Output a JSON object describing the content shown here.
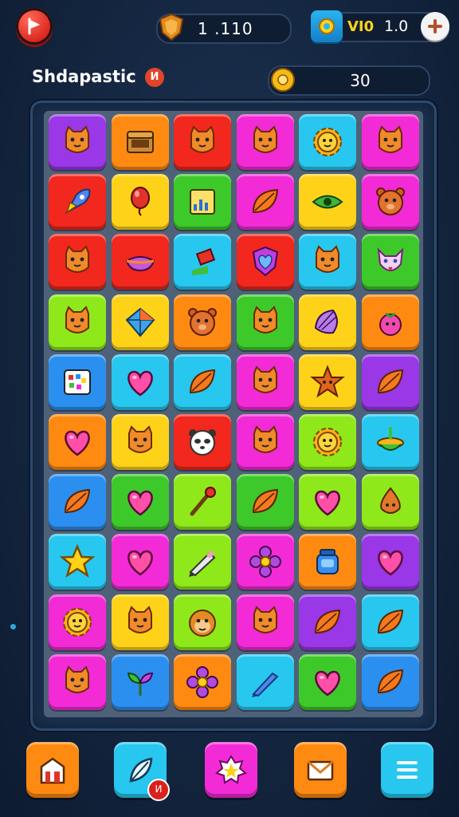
{
  "header": {
    "coins": "1 .110",
    "gem_label": "VI0",
    "gems": "1.0",
    "title": "Shdapastic",
    "title_badge": "И",
    "score": "30"
  },
  "icons": {
    "play": "play-flag-icon",
    "coin": "shield-coin-icon",
    "gem": "gear-gem-icon",
    "plus": "plus-icon",
    "score": "gold-gear-icon"
  },
  "colors": {
    "red": "#f2271d",
    "orange": "#ff8a12",
    "yellow": "#ffd21a",
    "lime": "#8ee81a",
    "green": "#3ec92a",
    "cyan": "#27c7ef",
    "blue": "#2b8ff0",
    "magenta": "#f22bd6",
    "purple": "#9a37e6",
    "pink": "#ff4aa8"
  },
  "board": {
    "rows": [
      [
        {
          "c": "purple",
          "i": "cat-icon"
        },
        {
          "c": "orange",
          "i": "chest-icon"
        },
        {
          "c": "red",
          "i": "cat-icon"
        },
        {
          "c": "magenta",
          "i": "cat-icon"
        },
        {
          "c": "cyan",
          "i": "sun-face-icon"
        },
        {
          "c": "magenta",
          "i": "cat-icon"
        }
      ],
      [
        {
          "c": "red",
          "i": "rocket-icon"
        },
        {
          "c": "yellow",
          "i": "balloon-icon"
        },
        {
          "c": "green",
          "i": "chart-icon"
        },
        {
          "c": "magenta",
          "i": "leaf-icon"
        },
        {
          "c": "yellow",
          "i": "eye-icon"
        },
        {
          "c": "magenta",
          "i": "bear-icon"
        }
      ],
      [
        {
          "c": "red",
          "i": "cat-icon"
        },
        {
          "c": "red",
          "i": "bowl-icon"
        },
        {
          "c": "cyan",
          "i": "flag-icon"
        },
        {
          "c": "red",
          "i": "heart-shield-icon"
        },
        {
          "c": "cyan",
          "i": "cat-icon"
        },
        {
          "c": "green",
          "i": "fox-icon"
        }
      ],
      [
        {
          "c": "lime",
          "i": "cat-icon"
        },
        {
          "c": "yellow",
          "i": "kite-icon"
        },
        {
          "c": "orange",
          "i": "bear-icon"
        },
        {
          "c": "green",
          "i": "cat-icon"
        },
        {
          "c": "yellow",
          "i": "shell-icon"
        },
        {
          "c": "orange",
          "i": "berry-icon"
        }
      ],
      [
        {
          "c": "blue",
          "i": "palette-icon"
        },
        {
          "c": "cyan",
          "i": "heart-icon"
        },
        {
          "c": "cyan",
          "i": "leaf-icon"
        },
        {
          "c": "magenta",
          "i": "cat-icon"
        },
        {
          "c": "yellow",
          "i": "star-face-icon"
        },
        {
          "c": "purple",
          "i": "leaf-icon"
        }
      ],
      [
        {
          "c": "orange",
          "i": "heart-icon"
        },
        {
          "c": "yellow",
          "i": "cat-icon"
        },
        {
          "c": "red",
          "i": "panda-icon"
        },
        {
          "c": "magenta",
          "i": "cat-icon"
        },
        {
          "c": "lime",
          "i": "sun-face-icon"
        },
        {
          "c": "cyan",
          "i": "top-icon"
        }
      ],
      [
        {
          "c": "blue",
          "i": "leaf-icon"
        },
        {
          "c": "green",
          "i": "heart-icon"
        },
        {
          "c": "lime",
          "i": "brush-icon"
        },
        {
          "c": "green",
          "i": "leaf-icon"
        },
        {
          "c": "lime",
          "i": "heart-icon"
        },
        {
          "c": "lime",
          "i": "drop-face-icon"
        }
      ],
      [
        {
          "c": "cyan",
          "i": "star-icon"
        },
        {
          "c": "magenta",
          "i": "heart-icon"
        },
        {
          "c": "lime",
          "i": "pencil-icon"
        },
        {
          "c": "magenta",
          "i": "flower-icon"
        },
        {
          "c": "orange",
          "i": "jar-icon"
        },
        {
          "c": "purple",
          "i": "heart-icon"
        }
      ],
      [
        {
          "c": "magenta",
          "i": "sun-face-icon"
        },
        {
          "c": "yellow",
          "i": "cat-icon"
        },
        {
          "c": "lime",
          "i": "monkey-icon"
        },
        {
          "c": "magenta",
          "i": "cat-icon"
        },
        {
          "c": "purple",
          "i": "leaf-icon"
        },
        {
          "c": "cyan",
          "i": "leaf-icon"
        }
      ],
      [
        {
          "c": "magenta",
          "i": "cat-icon"
        },
        {
          "c": "blue",
          "i": "sprout-icon"
        },
        {
          "c": "orange",
          "i": "flower-icon"
        },
        {
          "c": "cyan",
          "i": "pen-icon"
        },
        {
          "c": "green",
          "i": "heart-icon"
        },
        {
          "c": "blue",
          "i": "leaf-icon"
        }
      ]
    ]
  },
  "bottom_nav": [
    {
      "c": "orange",
      "i": "shop-icon"
    },
    {
      "c": "cyan",
      "i": "feather-icon",
      "badge": "И"
    },
    {
      "c": "magenta",
      "i": "star-badge-icon"
    },
    {
      "c": "orange",
      "i": "mail-icon"
    },
    {
      "c": "cyan",
      "i": "menu-icon"
    }
  ]
}
